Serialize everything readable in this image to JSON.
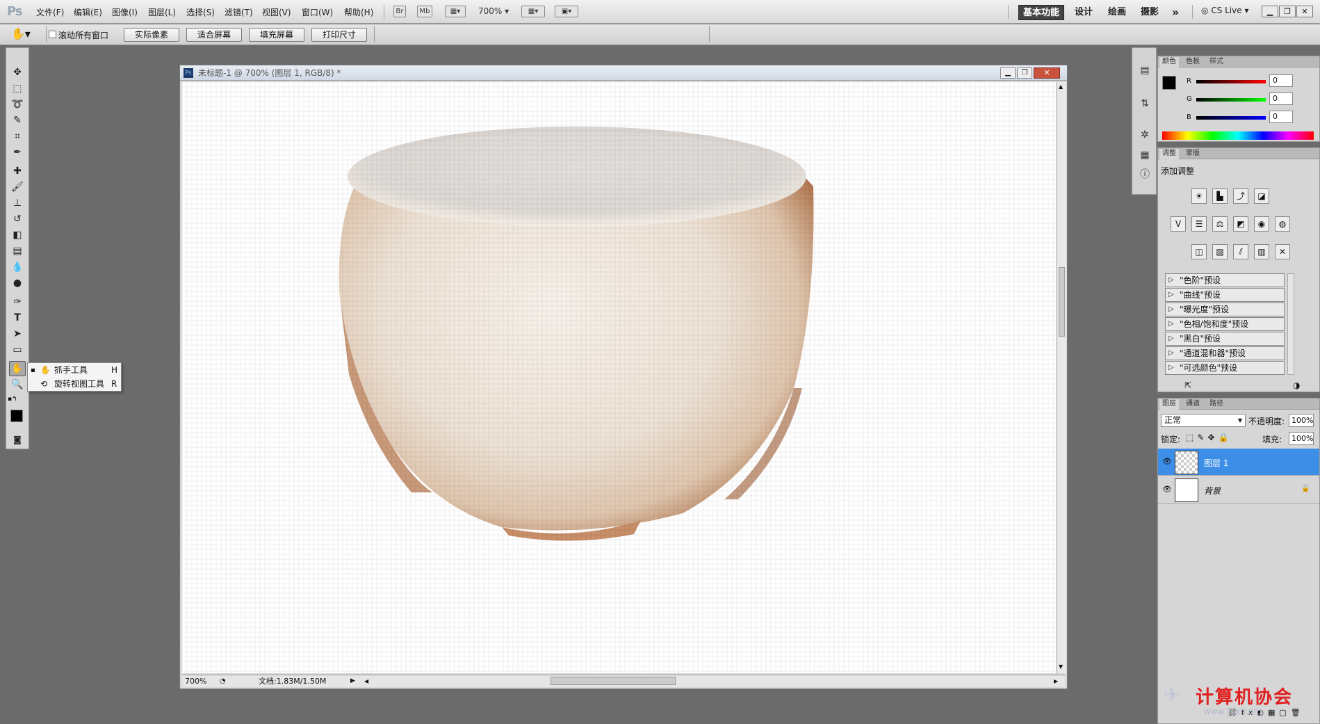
{
  "app": {
    "logo": "Ps"
  },
  "menu": [
    "文件(F)",
    "编辑(E)",
    "图像(I)",
    "图层(L)",
    "选择(S)",
    "滤镜(T)",
    "视图(V)",
    "窗口(W)",
    "帮助(H)"
  ],
  "menubar": {
    "bridge": "Br",
    "minibridge": "Mb",
    "zoom": "700%",
    "workspaces": [
      "基本功能",
      "设计",
      "绘画",
      "摄影"
    ],
    "more": "»",
    "cslive": "CS Live",
    "win_min": "▁",
    "win_restore": "❐",
    "win_close": "✕"
  },
  "options": {
    "scroll_all": "滚动所有窗口",
    "buttons": [
      "实际像素",
      "适合屏幕",
      "填充屏幕",
      "打印尺寸"
    ]
  },
  "flyout": {
    "items": [
      {
        "label": "抓手工具",
        "key": "H"
      },
      {
        "label": "旋转视图工具",
        "key": "R"
      }
    ]
  },
  "document": {
    "title": "未标题-1 @ 700% (图层 1, RGB/8) *",
    "zoom": "700%",
    "docinfo": "文档:1.83M/1.50M"
  },
  "color_panel": {
    "tabs": [
      "颜色",
      "色板",
      "样式"
    ],
    "channels": [
      {
        "label": "R",
        "value": "0"
      },
      {
        "label": "G",
        "value": "0"
      },
      {
        "label": "B",
        "value": "0"
      }
    ]
  },
  "adjust_panel": {
    "tabs": [
      "调整",
      "蒙版"
    ],
    "heading": "添加调整",
    "presets": [
      "\"色阶\"预设",
      "\"曲线\"预设",
      "\"曝光度\"预设",
      "\"色相/饱和度\"预设",
      "\"黑白\"预设",
      "\"通道混和器\"预设",
      "\"可选颜色\"预设"
    ]
  },
  "layers_panel": {
    "tabs": [
      "图层",
      "通道",
      "路径"
    ],
    "blend_mode": "正常",
    "opacity_label": "不透明度:",
    "opacity": "100%",
    "lock_label": "锁定:",
    "fill_label": "填充:",
    "fill": "100%",
    "layers": [
      {
        "name": "图层 1",
        "selected": true
      },
      {
        "name": "背景",
        "selected": false
      }
    ]
  },
  "watermark": {
    "text": "计算机协会",
    "url": "www.jsjxh.org"
  }
}
